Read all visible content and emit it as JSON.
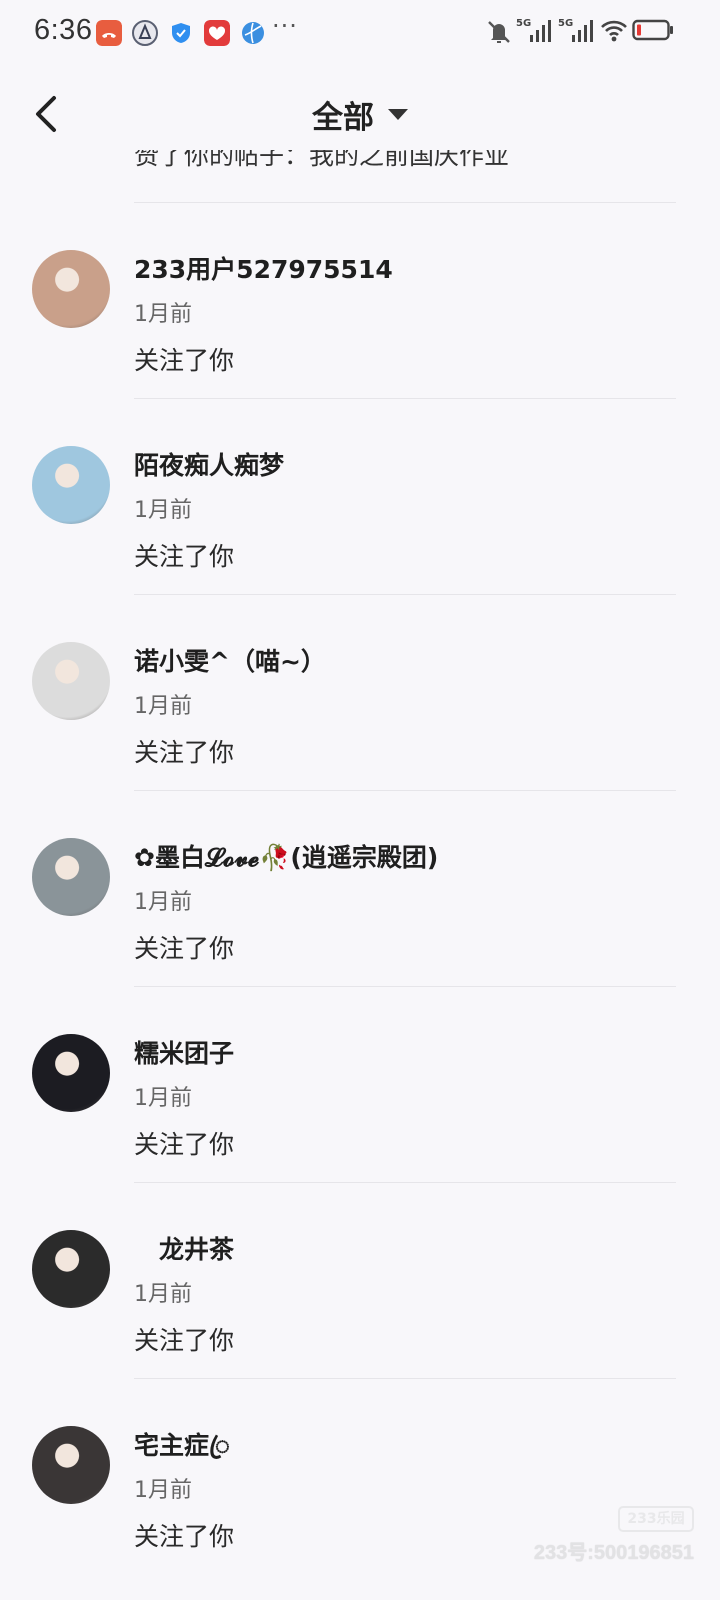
{
  "status_bar": {
    "time": "6:36",
    "network_1": "5G",
    "network_2": "5G",
    "icons": [
      "phone-app-icon",
      "shield-app-icon",
      "security-icon",
      "gift-app-icon",
      "browser-app-icon",
      "more-dots-icon",
      "mute-icon",
      "signal-icon",
      "signal-icon",
      "wifi-icon",
      "battery-icon"
    ],
    "more": "···"
  },
  "header": {
    "title": "全部"
  },
  "partial_item": {
    "text": "赞了你的帖子：我的之前国庆作业"
  },
  "notifications": [
    {
      "name": "233用户527975514",
      "time": "1月前",
      "action": "关注了你",
      "avatar_color": "#c9a08a"
    },
    {
      "name": "陌夜痴人痴梦",
      "time": "1月前",
      "action": "关注了你",
      "avatar_color": "#9fc7df"
    },
    {
      "name": "诺小雯^（喵~）",
      "time": "1月前",
      "action": "关注了你",
      "avatar_color": "#dcdcdc"
    },
    {
      "name": "✿墨白𝓛𝓸𝓿𝓮🥀(逍遥宗殿团)",
      "time": "1月前",
      "action": "关注了你",
      "avatar_color": "#8a9499"
    },
    {
      "name": "糯米团子",
      "time": "1月前",
      "action": "关注了你",
      "avatar_color": "#1c1c22"
    },
    {
      "name": "　龙井茶",
      "time": "1月前",
      "action": "关注了你",
      "avatar_color": "#2b2b2b"
    },
    {
      "name": "宅主症ꦿ",
      "time": "1月前",
      "action": "关注了你",
      "avatar_color": "#3a3636"
    }
  ],
  "watermark": {
    "logo": "233乐园",
    "text": "233号:500196851"
  }
}
